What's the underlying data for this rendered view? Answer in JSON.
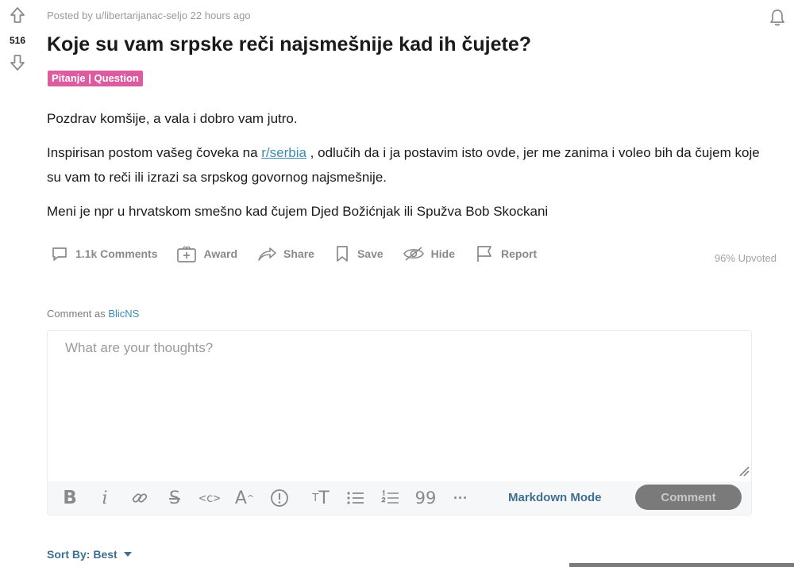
{
  "post": {
    "posted_by": "Posted by u/libertarijanac-seljo 22 hours ago",
    "votes": "516",
    "title": "Koje su vam srpske reči najsmešnije kad ih čujete?",
    "flair": "Pitanje | Question",
    "flair_color": "#dd5b9f",
    "paragraph1": "Pozdrav komšije, a vala i dobro vam jutro.",
    "paragraph2_before": "Inspirisan postom vašeg čoveka na ",
    "paragraph2_link": "r/serbia",
    "paragraph2_after": " , odlučih da i ja postavim isto ovde, jer me zanima i voleo bih da čujem koje su vam to reči ili izrazi sa srpskog govornog najsmešnije.",
    "paragraph3": "Meni je npr u hrvatskom smešno kad čujem Djed Božićnjak ili Spužva Bob Skockani"
  },
  "actions": {
    "comments": "1.1k Comments",
    "award": "Award",
    "share": "Share",
    "save": "Save",
    "hide": "Hide",
    "report": "Report",
    "upvoted": "96% Upvoted"
  },
  "comment_box": {
    "comment_as_label": "Comment as ",
    "username": "BlicNS",
    "placeholder": "What are your thoughts?",
    "markdown_mode": "Markdown Mode",
    "submit_label": "Comment",
    "toolbar_icons": [
      "bold-icon",
      "italic-icon",
      "link-icon",
      "strikethrough-icon",
      "inline-code-icon",
      "superscript-icon",
      "spoiler-icon",
      "heading-icon",
      "bulleted-list-icon",
      "numbered-list-icon",
      "quote-block-icon",
      "more-icon"
    ]
  },
  "sort": {
    "label": "Sort By: Best"
  },
  "colors": {
    "link": "#3f8bb0",
    "muted": "#878a8c",
    "comment_button": "#7a7a7a"
  }
}
